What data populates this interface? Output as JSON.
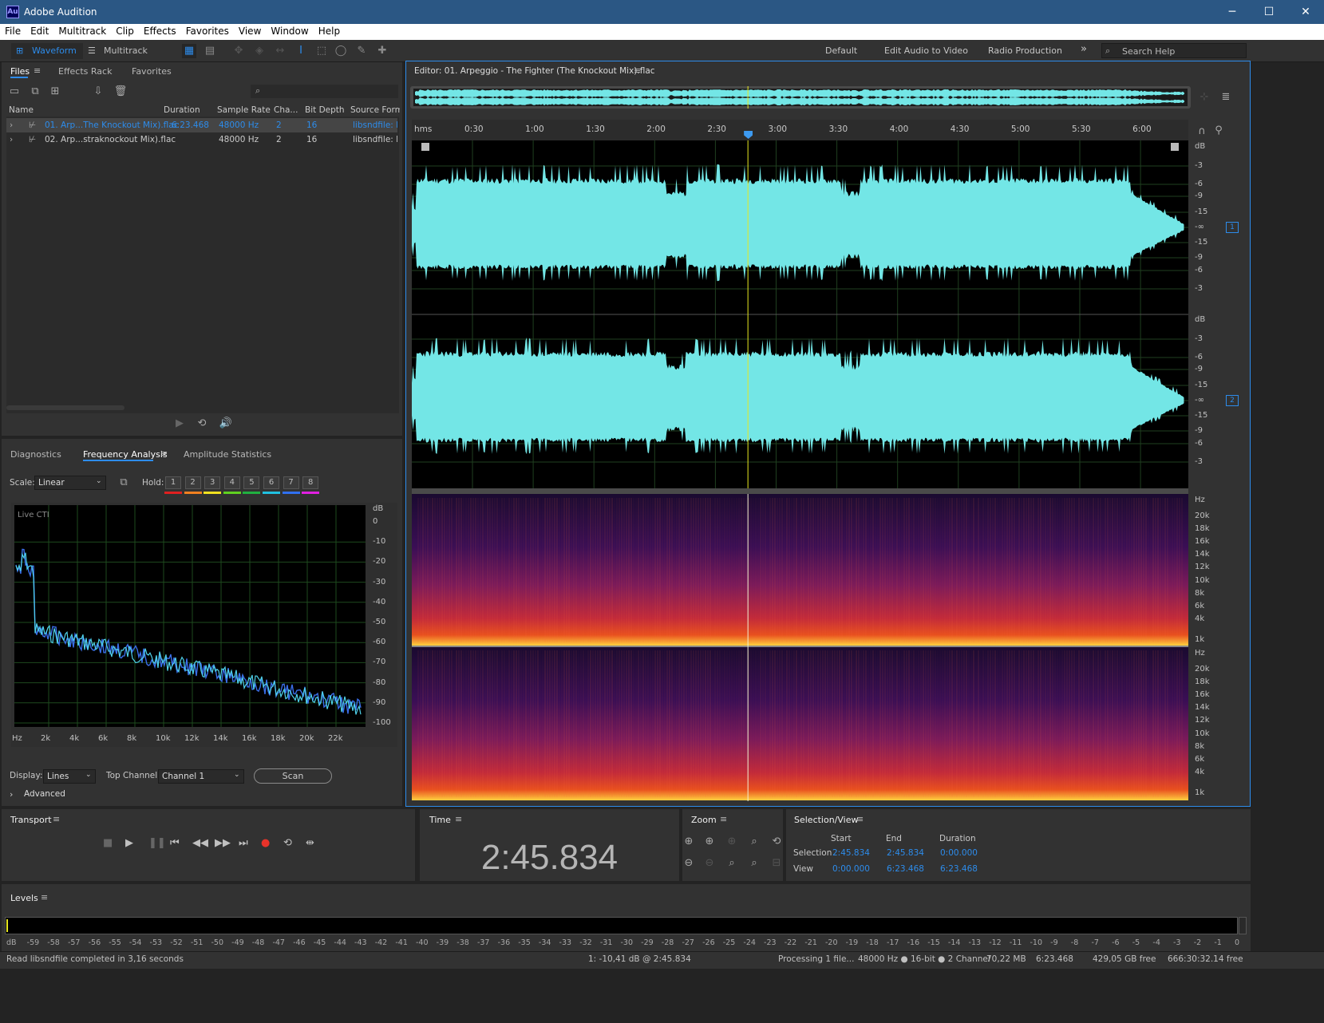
{
  "app": {
    "title": "Adobe Audition",
    "logo": "Au",
    "window_controls": [
      "─",
      "☐",
      "✕"
    ]
  },
  "menu": [
    "File",
    "Edit",
    "Multitrack",
    "Clip",
    "Effects",
    "Favorites",
    "View",
    "Window",
    "Help"
  ],
  "toolbar": {
    "waveform_label": "Waveform",
    "multitrack_label": "Multitrack",
    "workspaces": [
      "Default",
      "Edit Audio to Video",
      "Radio Production"
    ],
    "more": "»",
    "search_placeholder": "Search Help"
  },
  "files_panel": {
    "tabs": [
      "Files",
      "Effects Rack",
      "Favorites"
    ],
    "columns": [
      "Name",
      "Duration",
      "Sample Rate",
      "Cha...",
      "Bit Depth",
      "Source Forma"
    ],
    "rows": [
      {
        "name": "01. Arp...The Knockout Mix).flac",
        "duration": "6:23.468",
        "sample_rate": "48000 Hz",
        "channels": "2",
        "bit_depth": "16",
        "format": "libsndfile: FL",
        "selected": true
      },
      {
        "name": "02. Arp...straknockout Mix).flac",
        "duration": "",
        "sample_rate": "48000 Hz",
        "channels": "2",
        "bit_depth": "16",
        "format": "libsndfile: FL",
        "selected": false
      }
    ]
  },
  "analysis_panel": {
    "tabs": [
      "Diagnostics",
      "Frequency Analysis",
      "Amplitude Statistics"
    ],
    "scale_label": "Scale:",
    "scale_value": "Linear",
    "hold_label": "Hold:",
    "hold_buttons": [
      "1",
      "2",
      "3",
      "4",
      "5",
      "6",
      "7",
      "8"
    ],
    "hold_colors": [
      "#e02020",
      "#f08020",
      "#f0e020",
      "#60d020",
      "#20b040",
      "#20c0e0",
      "#3070f0",
      "#e020e0"
    ],
    "graph_label": "Live CTI",
    "db_unit": "dB",
    "db_ticks": [
      "0",
      "-10",
      "-20",
      "-30",
      "-40",
      "-50",
      "-60",
      "-70",
      "-80",
      "-90",
      "-100"
    ],
    "hz_ticks": [
      "Hz",
      "2k",
      "4k",
      "6k",
      "8k",
      "10k",
      "12k",
      "14k",
      "16k",
      "18k",
      "20k",
      "22k"
    ],
    "display_label": "Display:",
    "display_value": "Lines",
    "top_channel_label": "Top Channel:",
    "top_channel_value": "Channel 1",
    "scan_button": "Scan",
    "advanced_label": "Advanced"
  },
  "editor": {
    "title": "Editor: 01. Arpeggio - The Fighter (The Knockout Mix).flac",
    "ruler_unit": "hms",
    "ruler_ticks": [
      "0:30",
      "1:00",
      "1:30",
      "2:00",
      "2:30",
      "3:00",
      "3:30",
      "4:00",
      "4:30",
      "5:00",
      "5:30",
      "6:00"
    ],
    "db_unit": "dB",
    "db_scale": [
      "-3",
      "-6",
      "-9",
      "-15",
      "-∞",
      "-15",
      "-9",
      "-6",
      "-3"
    ],
    "channel_labels": [
      "1",
      "2"
    ],
    "hz_unit": "Hz",
    "hz_scale": [
      "20k",
      "18k",
      "16k",
      "14k",
      "12k",
      "10k",
      "8k",
      "6k",
      "4k",
      "1k"
    ],
    "waveform_color": "#73e6e6",
    "playhead_color": "#e8e820",
    "playhead_fraction": 0.4323
  },
  "transport": {
    "title": "Transport"
  },
  "time_panel": {
    "title": "Time",
    "value": "2:45.834"
  },
  "zoom_panel": {
    "title": "Zoom"
  },
  "selection_panel": {
    "title": "Selection/View",
    "headers": [
      "Start",
      "End",
      "Duration"
    ],
    "selection_label": "Selection",
    "selection": [
      "2:45.834",
      "2:45.834",
      "0:00.000"
    ],
    "view_label": "View",
    "view": [
      "0:00.000",
      "6:23.468",
      "6:23.468"
    ]
  },
  "levels": {
    "title": "Levels",
    "scale": [
      "dB",
      "-59",
      "-58",
      "-57",
      "-56",
      "-55",
      "-54",
      "-53",
      "-52",
      "-51",
      "-50",
      "-49",
      "-48",
      "-47",
      "-46",
      "-45",
      "-44",
      "-43",
      "-42",
      "-41",
      "-40",
      "-39",
      "-38",
      "-37",
      "-36",
      "-35",
      "-34",
      "-33",
      "-32",
      "-31",
      "-30",
      "-29",
      "-28",
      "-27",
      "-26",
      "-25",
      "-24",
      "-23",
      "-22",
      "-21",
      "-20",
      "-19",
      "-18",
      "-17",
      "-16",
      "-15",
      "-14",
      "-13",
      "-12",
      "-11",
      "-10",
      "-9",
      "-8",
      "-7",
      "-6",
      "-5",
      "-4",
      "-3",
      "-2",
      "-1",
      "0"
    ]
  },
  "status_bar": {
    "left": "Read libsndfile completed in 3,16 seconds",
    "cursor": "1: -10,41 dB @ 2:45.834",
    "processing": "Processing 1 file...",
    "format": "48000 Hz ● 16-bit ● 2 Channel",
    "size": "70,22 MB",
    "duration": "6:23.468",
    "free": "429,05 GB free",
    "free_time": "666:30:32.14 free"
  }
}
